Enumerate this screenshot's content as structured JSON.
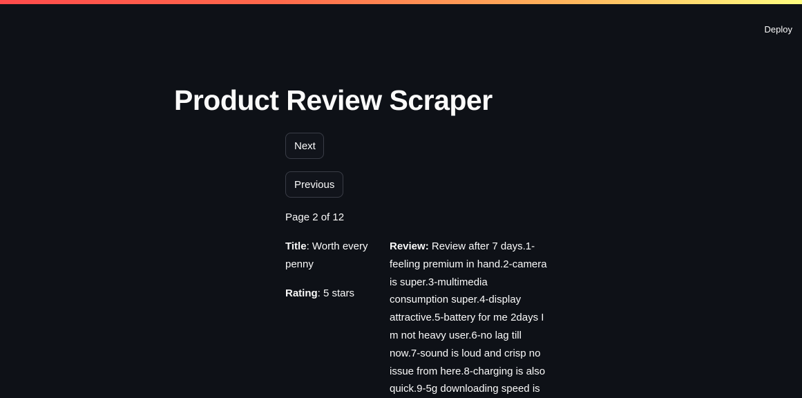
{
  "header": {
    "deploy_label": "Deploy"
  },
  "main": {
    "title": "Product Review Scraper",
    "next_label": "Next",
    "previous_label": "Previous",
    "page_indicator": "Page 2 of 12",
    "review": {
      "title_label": "Title",
      "title_value": ": Worth every penny",
      "rating_label": "Rating",
      "rating_value": ": 5 stars",
      "review_label": "Review:",
      "review_text": " Review after 7 days.1-feeling premium in hand.2-camera is super.3-multimedia consumption super.4-display attractive.5-battery for me 2days I m not heavy user.6-no lag till now.7-sound is loud and crisp no issue from here.8-charging is also quick.9-5g downloading speed is"
    }
  },
  "colors": {
    "background": "#0e1117",
    "text": "#fafafa",
    "button_border": "#3a3d47",
    "accent_gradient_start": "#ff4b4b",
    "accent_gradient_end": "#fffd80"
  }
}
